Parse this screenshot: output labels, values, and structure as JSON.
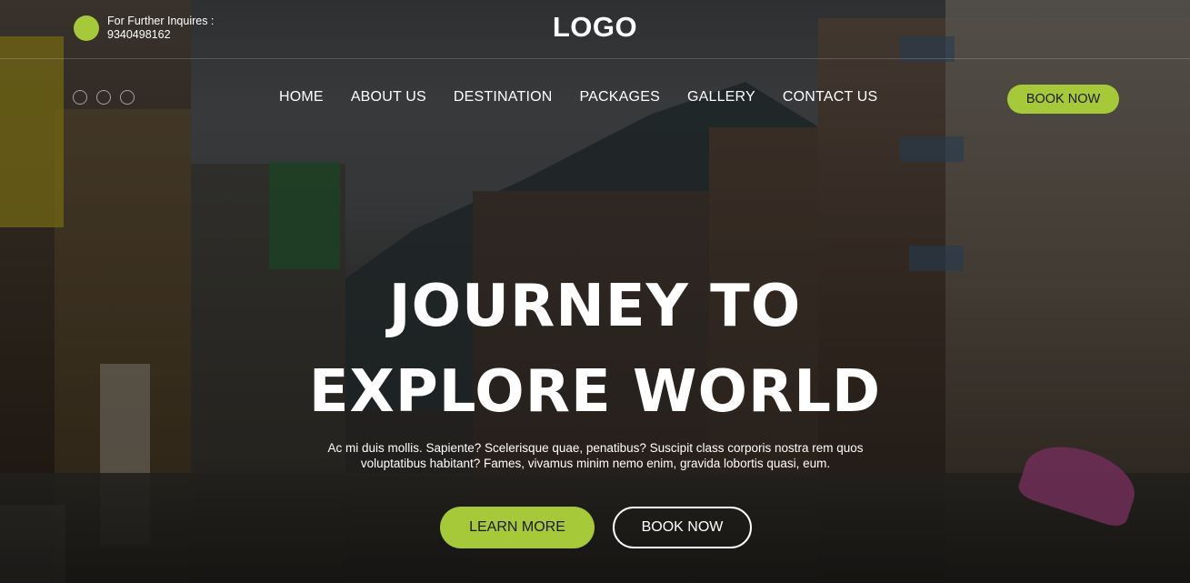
{
  "colors": {
    "accent": "#a6c93a",
    "text": "#ffffff",
    "overlay": "rgba(0,0,0,0.38)"
  },
  "header": {
    "contact_label": "For Further Inquires :",
    "contact_phone": "9340498162",
    "logo_text": "LOGO"
  },
  "social_icons": [
    "social-circle-icon",
    "social-circle-icon",
    "social-circle-icon"
  ],
  "nav": {
    "items": [
      {
        "label": "HOME"
      },
      {
        "label": "ABOUT US"
      },
      {
        "label": "DESTINATION"
      },
      {
        "label": "PACKAGES"
      },
      {
        "label": "GALLERY"
      },
      {
        "label": "CONTACT US"
      }
    ],
    "cta_label": "BOOK NOW"
  },
  "hero": {
    "headline_line1": "JOURNEY TO",
    "headline_line2": "EXPLORE WORLD",
    "subtext_line1": "Ac mi duis mollis. Sapiente? Scelerisque quae, penatibus? Suscipit class corporis nostra rem quos",
    "subtext_line2": "voluptatibus habitant? Fames, vivamus minim nemo enim, gravida lobortis quasi, eum.",
    "primary_button": "LEARN MORE",
    "secondary_button": "BOOK NOW"
  }
}
